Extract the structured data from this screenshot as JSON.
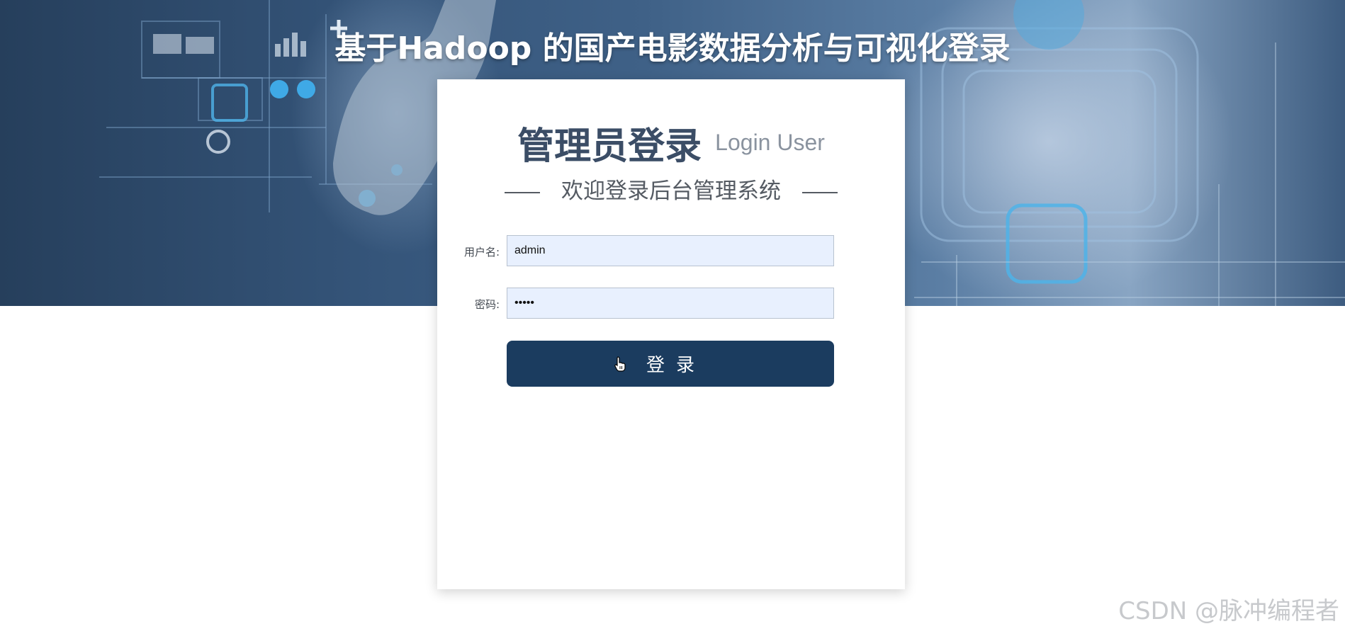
{
  "page": {
    "site_title": "基于Hadoop 的国产电影数据分析与可视化登录",
    "watermark": "CSDN @脉冲编程者"
  },
  "login_card": {
    "heading_cn": "管理员登录",
    "heading_en": "Login User",
    "welcome": "欢迎登录后台管理系统",
    "username_label": "用户名:",
    "username_value": "admin",
    "password_label": "密码:",
    "password_value": "admin",
    "submit_label": "登录"
  },
  "icons": {
    "background": "tech-touch-interface-illustration",
    "cursor": "hand-pointer-icon"
  },
  "colors": {
    "button_bg": "#1b3c5f",
    "heading": "#3b4d66",
    "input_autofill_bg": "#e8f0fe"
  }
}
